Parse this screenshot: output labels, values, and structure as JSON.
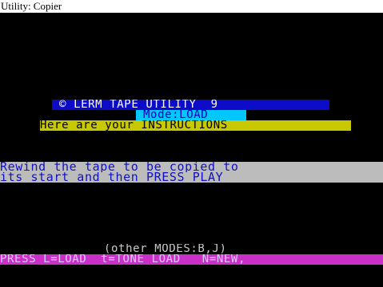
{
  "window": {
    "title": "Utility: Copier"
  },
  "screen": {
    "title_line": " © LERM TAPE UTILITY  9 ",
    "mode_line": " Mode:LOAD ",
    "instructions_line": "Here are your INSTRUCTIONS",
    "message_line_1": "Rewind the tape to be copied to",
    "message_line_2": "its start and then PRESS PLAY",
    "other_modes_line": "(other MODES:B,J)",
    "press_line": "PRESS L=LOAD  t=TONE LOAD   N=NEW,"
  },
  "colors": {
    "background": "#000000",
    "title_bg": "#0b0bc8",
    "mode_bg": "#00c8ff",
    "instructions_bg": "#c8c800",
    "message_bg": "#bcbcbc",
    "press_bg": "#c830c8"
  }
}
